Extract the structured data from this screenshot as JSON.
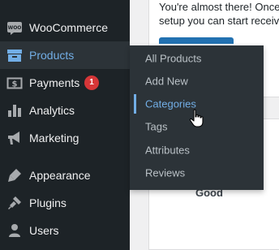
{
  "sidebar": {
    "items": [
      {
        "label": "WooCommerce",
        "icon": "woocommerce-icon"
      },
      {
        "label": "Products",
        "icon": "products-icon"
      },
      {
        "label": "Payments",
        "icon": "payments-icon",
        "badge": "1"
      },
      {
        "label": "Analytics",
        "icon": "analytics-icon"
      },
      {
        "label": "Marketing",
        "icon": "marketing-icon"
      },
      {
        "label": "Appearance",
        "icon": "appearance-icon"
      },
      {
        "label": "Plugins",
        "icon": "plugins-icon"
      },
      {
        "label": "Users",
        "icon": "users-icon"
      }
    ]
  },
  "submenu": {
    "items": [
      {
        "label": "All Products"
      },
      {
        "label": "Add New"
      },
      {
        "label": "Categories"
      },
      {
        "label": "Tags"
      },
      {
        "label": "Attributes"
      },
      {
        "label": "Reviews"
      }
    ]
  },
  "woo_icon_text": "WOO",
  "main": {
    "line1": "You're almost there! Once",
    "line2": "setup you can start receivi",
    "rating": "Good"
  },
  "colors": {
    "sidebar_bg": "#1d2327",
    "submenu_bg": "#2c3338",
    "accent": "#72aee6",
    "badge": "#d63638",
    "primary_button": "#2271b1"
  }
}
